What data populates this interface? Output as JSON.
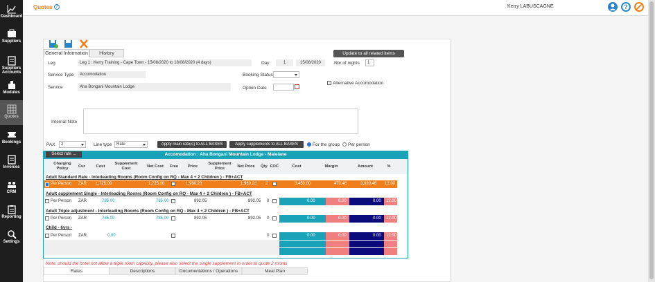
{
  "sidebar": {
    "items": [
      {
        "label": "Dashboard"
      },
      {
        "label": "Suppliers"
      },
      {
        "label": "Suppliers Accounts"
      },
      {
        "label": "Modules"
      },
      {
        "label": "Quotes"
      },
      {
        "label": "Bookings"
      },
      {
        "label": "Invoices"
      },
      {
        "label": "CRM"
      },
      {
        "label": "Reporting"
      },
      {
        "label": "Settings"
      }
    ]
  },
  "header": {
    "title": "Quotes",
    "user": "Kerry LABUSCAGNE"
  },
  "tabs": [
    "General Information",
    "History"
  ],
  "update_btn": "Update to all related items",
  "leg": {
    "label": "Leg",
    "value": "Leg 1 : Kerry Training - Cape Town - 15/08/2020 to 18/08/2020 (4 days)",
    "day_label": "Day",
    "day": "1",
    "date": "15/08/2020",
    "nights_label": "Nbr of nights",
    "nights": "1"
  },
  "service_type": {
    "label": "Service Type",
    "value": "Accomodation"
  },
  "service": {
    "label": "Service",
    "value": "Aha Bongani Mountain Lodge"
  },
  "booking_status": {
    "label": "Booking Status"
  },
  "option_date": {
    "label": "Option Date"
  },
  "alt_accom": "Alternative Accomodation",
  "internal_note": "Internal Note",
  "pax": {
    "label": "PAX",
    "value": "2"
  },
  "line_type": {
    "label": "Line type",
    "value": "Rate"
  },
  "apply_main": "Apply main rate(s) to ALL BASES",
  "apply_supp": "Apply supplements to ALL BASES",
  "for_group": "For the group",
  "per_person": "Per person",
  "select_rate": "Select rate ...",
  "accom_title": "Accomodation : Aha Bongani Mountain Lodge - Malelane",
  "headers": [
    "Charging Policy",
    "Cur",
    "Cost",
    "Supplement Cost",
    "Net Cost",
    "Free",
    "Price",
    "Supplement Price",
    "Net Price",
    "Qty",
    "FOC",
    "Cost",
    "Margin",
    "Amount",
    "%"
  ],
  "sections": [
    {
      "title": "Adult Standard Rate - Interleading Rooms (Room Config on RQ - Max 4 + 2 Children ) - FB+ACT",
      "policy": "Per Person",
      "cur": "ZAR",
      "cost": "1,725.00",
      "net_cost": "1,725.00",
      "price": "1,960.23",
      "net_price": "1,960.23",
      "qty": "2",
      "tcost": "3,450.00",
      "margin": "470.46",
      "amount": "3,920.46",
      "pct": "12.00"
    },
    {
      "title": "Adult supplement Single - Interleading Rooms (Room Config on RQ - Max 4 + 2 Children ) - FB+ACT",
      "policy": "Per Person",
      "cur": "ZAR",
      "cost": "785.00",
      "net_cost": "785.00",
      "price": "892.05",
      "net_price": "892.05",
      "qty": "0",
      "tcost": "0.00",
      "margin": "0.00",
      "amount": "0.00",
      "pct": "12.00"
    },
    {
      "title": "Adult Triple adjustment - Interleading Rooms (Room Config on RQ - Max 4 + 2 Children ) - FB+ACT",
      "policy": "Per Person",
      "cur": "ZAR",
      "cost": "785.00",
      "net_cost": "785.00",
      "price": "892.05",
      "net_price": "892.05",
      "qty": "0",
      "tcost": "0.00",
      "margin": "0.00",
      "amount": "0.00",
      "pct": "12.00"
    },
    {
      "title": "Child - 6yrs -",
      "policy": "Per Person",
      "cur": "ZAR",
      "cost": "0.00",
      "net_cost": "",
      "price": "",
      "net_price": "",
      "qty": "0",
      "tcost": "0.00",
      "margin": "0.00",
      "amount": "0.00",
      "pct": "12.00"
    }
  ],
  "note": "Note: should the hotel not allow a triple room capacity, please also select the single supplement in order to quote 2 rooms",
  "bottom_tabs": [
    "Rates",
    "Descriptions",
    "Documentations / Operations",
    "Meal Plan"
  ],
  "colors": {
    "orange": "#f07f1b",
    "teal": "#1aa3b8",
    "pink": "#f08080",
    "navy": "#0a0a7a",
    "sidebar": "#1e1e1e"
  }
}
